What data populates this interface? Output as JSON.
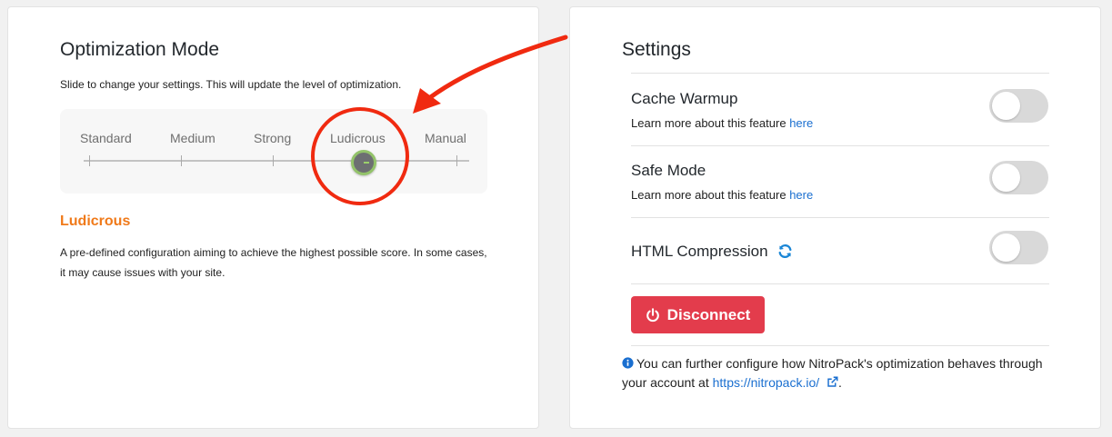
{
  "optimization": {
    "title": "Optimization Mode",
    "description": "Slide to change your settings. This will update the level of optimization.",
    "levels": [
      "Standard",
      "Medium",
      "Strong",
      "Ludicrous",
      "Manual"
    ],
    "selected_level": "Ludicrous",
    "selected_index": 3,
    "mode_title": "Ludicrous",
    "mode_description": "A pre-defined configuration aiming to achieve the highest possible score. In some cases, it may cause issues with your site."
  },
  "settings": {
    "title": "Settings",
    "cache_warmup": {
      "label": "Cache Warmup",
      "sub": "Learn more about this feature",
      "link": "here",
      "enabled": false
    },
    "safe_mode": {
      "label": "Safe Mode",
      "sub": "Learn more about this feature",
      "link": "here",
      "enabled": false
    },
    "html_compression": {
      "label": "HTML Compression",
      "enabled": false
    },
    "disconnect_label": "Disconnect",
    "info_text": "You can further configure how NitroPack's optimization behaves through your account at",
    "info_link": "https://nitropack.io/",
    "info_end": "."
  },
  "colors": {
    "accent_orange": "#f07a1a",
    "link_blue": "#1a6fd0",
    "disconnect_red": "#e33c4c",
    "annotation_red": "#f02a10"
  }
}
